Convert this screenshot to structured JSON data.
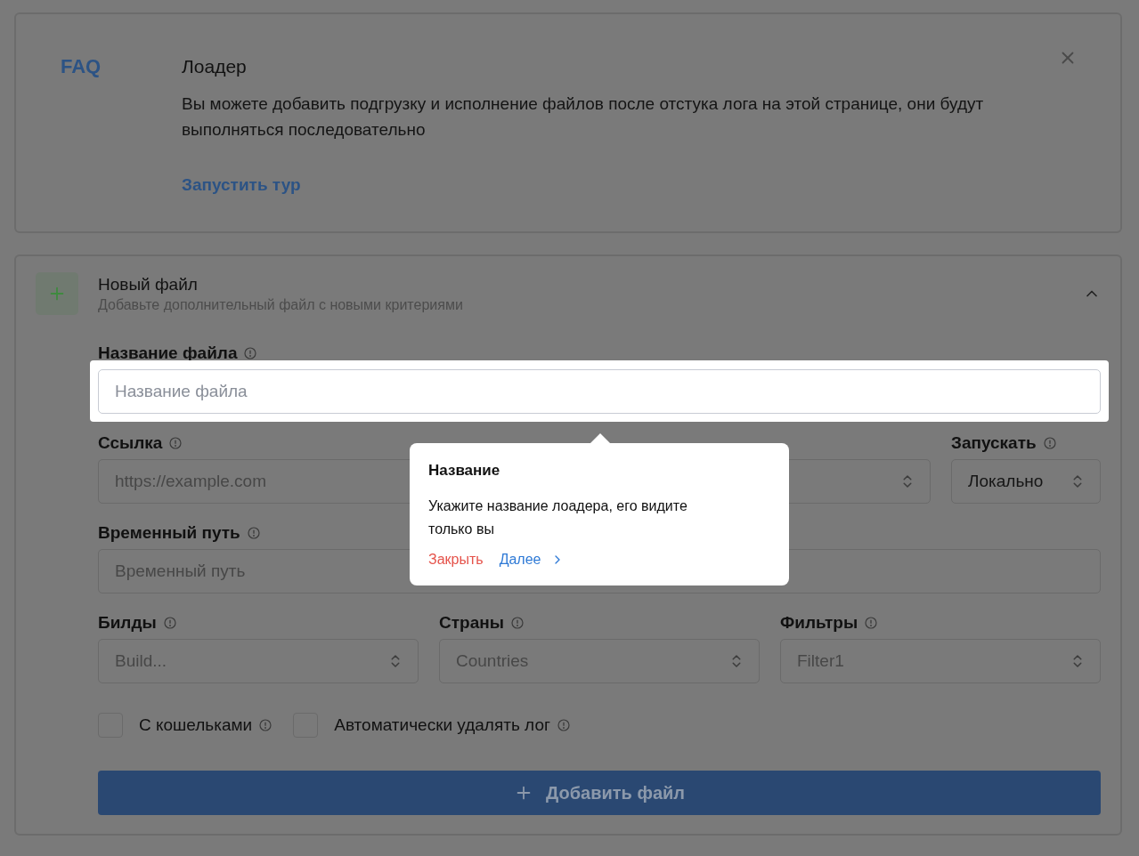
{
  "faq": {
    "badge": "FAQ",
    "title": "Лоадер",
    "description": "Вы можете добавить подгрузку и исполнение файлов после отстука лога на этой странице, они будут выполняться последовательно",
    "tour_link": "Запустить тур"
  },
  "new_file": {
    "title": "Новый файл",
    "subtitle": "Добавьте дополнительный файл с новыми критериями",
    "expanded": true,
    "rows": [
      [
        {
          "kind": "input",
          "label": "Название файла",
          "placeholder": "Название файла",
          "highlighted": true
        }
      ],
      [
        {
          "kind": "input",
          "label": "Ссылка",
          "placeholder": "https://example.com",
          "highlighted": false
        },
        {
          "kind": "select",
          "highlighted": false
        },
        {
          "kind": "select",
          "label": "Запускать",
          "value": "Локально",
          "highlighted": false
        }
      ],
      [
        {
          "kind": "input",
          "label": "Временный путь",
          "placeholder": "Временный путь",
          "highlighted": false
        }
      ],
      [
        {
          "kind": "select",
          "label": "Билды",
          "placeholder": "Build...",
          "highlighted": false
        },
        {
          "kind": "select",
          "label": "Страны",
          "placeholder": "Countries",
          "highlighted": false
        },
        {
          "kind": "select",
          "label": "Фильтры",
          "placeholder": "Filter1",
          "highlighted": false
        }
      ]
    ],
    "checkboxes": [
      {
        "label": "С кошельками",
        "checked": false
      },
      {
        "label": "Автоматически удалять лог",
        "checked": false
      }
    ],
    "add_button": {
      "label": "Добавить файл"
    }
  },
  "tour_popover": {
    "title": "Название",
    "text": "Укажите название лоадера, его видите только вы",
    "close": "Закрыть",
    "next": "Далее"
  }
}
